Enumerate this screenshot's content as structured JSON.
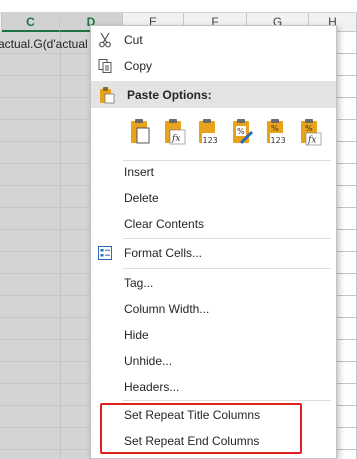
{
  "sheet": {
    "column_headers": [
      "C",
      "D",
      "E",
      "F",
      "G",
      "H"
    ],
    "selected_columns": [
      "C",
      "D"
    ],
    "cell_text": "actual.G(d'actual"
  },
  "context_menu": {
    "cut_label": "Cut",
    "copy_label": "Copy",
    "paste_options_label": "Paste Options:",
    "paste_icons": [
      "paste-icon",
      "paste-formula-icon",
      "paste-values-icon",
      "paste-formatting-icon",
      "paste-values-number-format-icon",
      "paste-formula-number-format-icon"
    ],
    "paste_icon_captions": [
      "fx",
      "123",
      "%",
      "123",
      "fx"
    ],
    "insert_label": "Insert",
    "delete_label": "Delete",
    "clear_contents_label": "Clear Contents",
    "format_cells_label": "Format Cells...",
    "tag_label": "Tag...",
    "column_width_label": "Column Width...",
    "hide_label": "Hide",
    "unhide_label": "Unhide...",
    "headers_label": "Headers...",
    "set_repeat_title_label": "Set Repeat Title Columns",
    "set_repeat_end_label": "Set Repeat End Columns"
  },
  "colors": {
    "accent_green": "#217346",
    "clipboard_orange": "#e8a21b",
    "highlight_red": "#e0201c",
    "selection_gray": "#d4d4d4"
  }
}
